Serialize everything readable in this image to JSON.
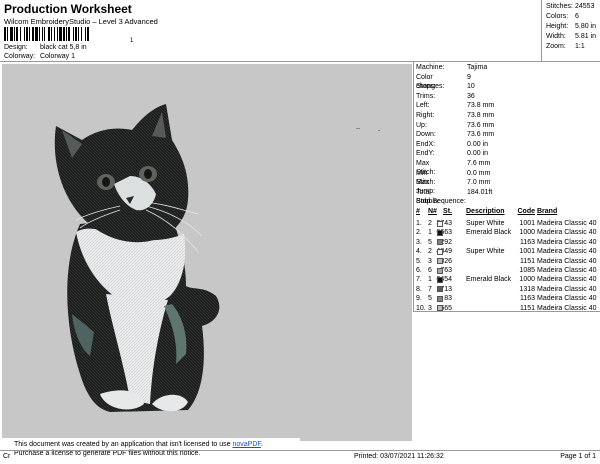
{
  "header": {
    "title": "Production Worksheet",
    "subtitle": "Wilcom EmbroideryStudio – Level 3 Advanced",
    "barcode_label": "1",
    "design_label": "Design:",
    "design_value": "black cat 5,8 in",
    "colorway_label": "Colorway:",
    "colorway_value": "Colorway 1"
  },
  "stats": [
    {
      "label": "Stitches:",
      "value": "24553"
    },
    {
      "label": "Colors:",
      "value": "6"
    },
    {
      "label": "Height:",
      "value": "5.80 in"
    },
    {
      "label": "Width:",
      "value": "5.81 in"
    },
    {
      "label": "Zoom:",
      "value": "1:1"
    }
  ],
  "machine": [
    {
      "label": "Machine:",
      "value": "Tajima"
    },
    {
      "label": "Color changes:",
      "value": "9"
    },
    {
      "label": "Stops:",
      "value": "10"
    },
    {
      "label": "Trims:",
      "value": "36"
    },
    {
      "label": "Left:",
      "value": "73.8 mm"
    },
    {
      "label": "Right:",
      "value": "73.8 mm"
    },
    {
      "label": "Up:",
      "value": "73.6 mm"
    },
    {
      "label": "Down:",
      "value": "73.6 mm"
    },
    {
      "label": "EndX:",
      "value": "0.00 in"
    },
    {
      "label": "EndY:",
      "value": "0.00 in"
    },
    {
      "label": "Max Stitch:",
      "value": "7.6 mm"
    },
    {
      "label": "Min Stitch:",
      "value": "0.0 mm"
    },
    {
      "label": "Max Jump:",
      "value": "7.0 mm"
    },
    {
      "label": "Total Bobbin:",
      "value": "184.01ft"
    }
  ],
  "stop_sequence": {
    "title": "Stop Sequence:",
    "headers": {
      "num": "#",
      "n": "N#",
      "st": "St.",
      "desc": "Description",
      "code": "Code",
      "brand": "Brand"
    },
    "rows": [
      {
        "num": "1.",
        "n": "2",
        "color": "#f4f4f4",
        "st": "3743",
        "desc": "Super White",
        "code": "1001",
        "brand": "Madeira Classic 40"
      },
      {
        "num": "2.",
        "n": "1",
        "color": "#111111",
        "st": "6663",
        "desc": "Emerald Black",
        "code": "1000",
        "brand": "Madeira Classic 40"
      },
      {
        "num": "3.",
        "n": "5",
        "color": "#7d8580",
        "st": "292",
        "desc": "",
        "code": "1163",
        "brand": "Madeira Classic 40"
      },
      {
        "num": "4.",
        "n": "2",
        "color": "#f4f4f4",
        "st": "4849",
        "desc": "Super White",
        "code": "1001",
        "brand": "Madeira Classic 40"
      },
      {
        "num": "5.",
        "n": "3",
        "color": "#b9bcc0",
        "st": "326",
        "desc": "",
        "code": "1151",
        "brand": "Madeira Classic 40"
      },
      {
        "num": "6.",
        "n": "6",
        "color": "#a7a7a3",
        "st": "763",
        "desc": "",
        "code": "1085",
        "brand": "Madeira Classic 40"
      },
      {
        "num": "7.",
        "n": "1",
        "color": "#111111",
        "st": "6454",
        "desc": "Emerald Black",
        "code": "1000",
        "brand": "Madeira Classic 40"
      },
      {
        "num": "8.",
        "n": "7",
        "color": "#5a5f5c",
        "st": "713",
        "desc": "",
        "code": "1318",
        "brand": "Madeira Classic 40"
      },
      {
        "num": "9.",
        "n": "5",
        "color": "#7d8580",
        "st": "83",
        "desc": "",
        "code": "1163",
        "brand": "Madeira Classic 40"
      },
      {
        "num": "10.",
        "n": "3",
        "color": "#b9bcc0",
        "st": "665",
        "desc": "",
        "code": "1151",
        "brand": "Madeira Classic 40"
      }
    ]
  },
  "notice": {
    "line1": "This document was created by an application that isn't licensed to use ",
    "link": "novaPDF",
    "line1_end": ".",
    "line2": "Purchase a license to generate PDF files without this notice."
  },
  "footer": {
    "left": "Cr",
    "printed": "Printed: 03/07/2021 11:26:32",
    "page": "Page 1 of 1"
  }
}
